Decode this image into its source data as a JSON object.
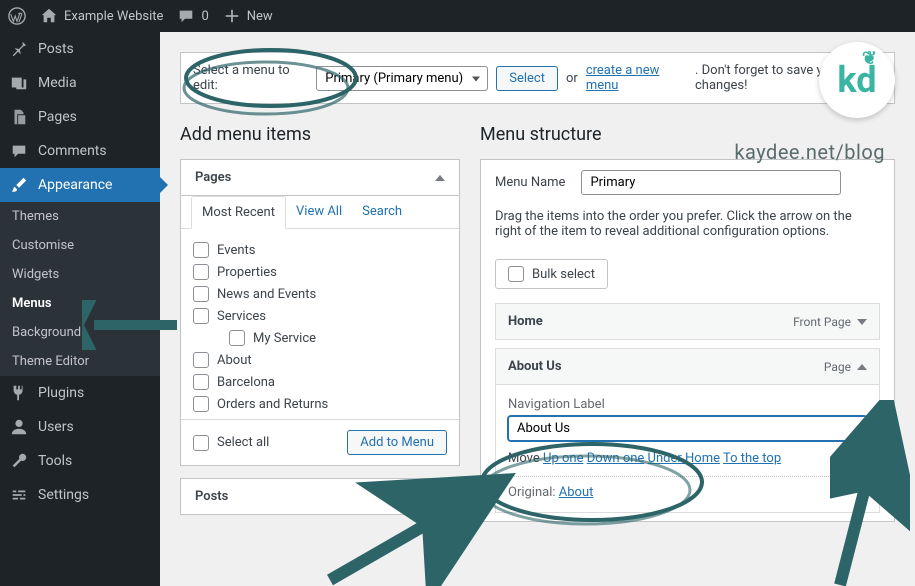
{
  "adminbar": {
    "site_name": "Example Website",
    "comment_count": "0",
    "new_label": "New"
  },
  "sidebar": {
    "items": [
      {
        "label": "Posts",
        "icon": "pin"
      },
      {
        "label": "Media",
        "icon": "media"
      },
      {
        "label": "Pages",
        "icon": "page"
      },
      {
        "label": "Comments",
        "icon": "comment"
      },
      {
        "label": "Appearance",
        "icon": "brush",
        "active": true
      },
      {
        "label": "Plugins",
        "icon": "plug"
      },
      {
        "label": "Users",
        "icon": "user"
      },
      {
        "label": "Tools",
        "icon": "wrench"
      },
      {
        "label": "Settings",
        "icon": "sliders"
      }
    ],
    "appearance_sub": [
      {
        "label": "Themes"
      },
      {
        "label": "Customise"
      },
      {
        "label": "Widgets"
      },
      {
        "label": "Menus",
        "current": true
      },
      {
        "label": "Background"
      },
      {
        "label": "Theme Editor"
      }
    ]
  },
  "notice": {
    "select_label": "Select a menu to edit:",
    "menu_dropdown": "Primary (Primary menu)",
    "select_btn": "Select",
    "or": "or",
    "create_link": "create a new menu",
    "trail": ". Don't forget to save your changes!"
  },
  "add_panel": {
    "heading": "Add menu items",
    "pages_title": "Pages",
    "tabs": {
      "recent": "Most Recent",
      "view_all": "View All",
      "search": "Search"
    },
    "pages": [
      {
        "label": "Events",
        "indent": 0
      },
      {
        "label": "Properties",
        "indent": 0
      },
      {
        "label": "News and Events",
        "indent": 0
      },
      {
        "label": "Services",
        "indent": 0
      },
      {
        "label": "My Service",
        "indent": 2
      },
      {
        "label": "About",
        "indent": 0
      },
      {
        "label": "Barcelona",
        "indent": 0
      },
      {
        "label": "Orders and Returns",
        "indent": 0
      }
    ],
    "select_all": "Select all",
    "add_to_menu": "Add to Menu",
    "posts_title": "Posts"
  },
  "structure": {
    "heading": "Menu structure",
    "menu_name_label": "Menu Name",
    "menu_name_value": "Primary",
    "instructions": "Drag the items into the order you prefer. Click the arrow on the right of the item to reveal additional configuration options.",
    "bulk_select": "Bulk select",
    "items": [
      {
        "title": "Home",
        "type": "Front Page",
        "expanded": false
      },
      {
        "title": "About Us",
        "type": "Page",
        "expanded": true
      }
    ],
    "nav_label_label": "Navigation Label",
    "nav_label_value": "About Us",
    "move_label": "Move",
    "move_links": [
      "Up one",
      "Down one",
      "Under Home",
      "To the top"
    ],
    "original_label": "Original:",
    "original_link": "About"
  },
  "watermark": "kaydee.net/blog",
  "logo_text": "kd"
}
